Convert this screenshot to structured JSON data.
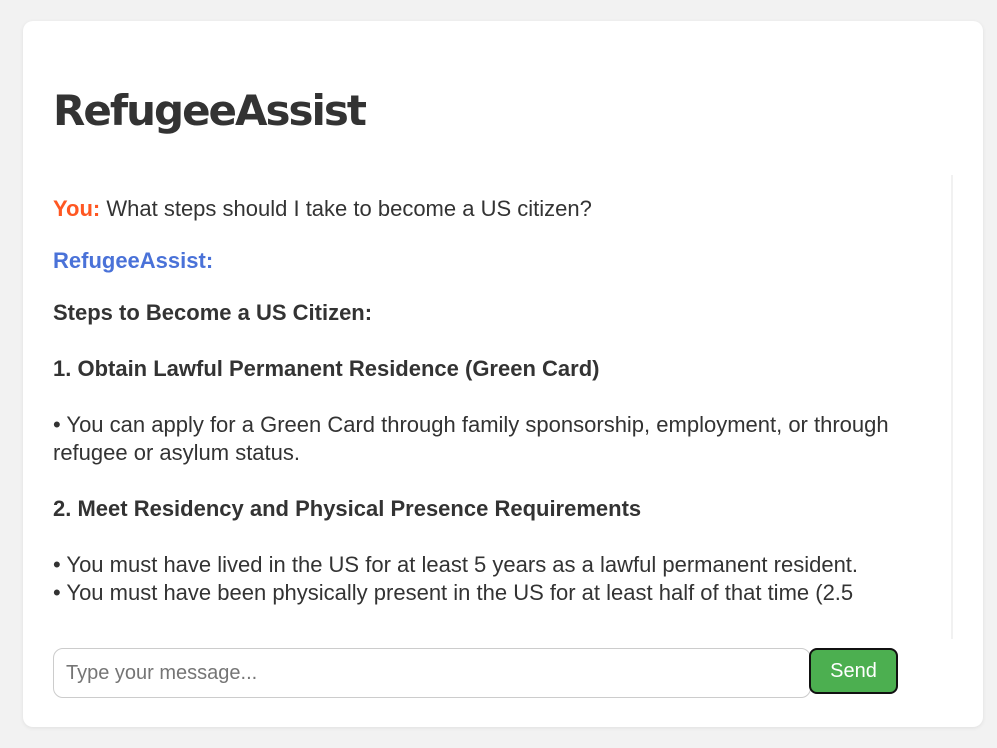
{
  "app": {
    "title": "RefugeeAssist"
  },
  "conversation": {
    "user_label": "You:",
    "user_message": "What steps should I take to become a US citizen?",
    "bot_label": "RefugeeAssist:",
    "response": {
      "title": "Steps to Become a US Citizen:",
      "steps": [
        {
          "heading": "1. Obtain Lawful Permanent Residence (Green Card)",
          "bullets": [
            "• You can apply for a Green Card through family sponsorship, employment, or through refugee or asylum status."
          ]
        },
        {
          "heading": "2. Meet Residency and Physical Presence Requirements",
          "bullets": [
            "• You must have lived in the US for at least 5 years as a lawful permanent resident.",
            "• You must have been physically present in the US for at least half of that time (2.5"
          ]
        }
      ]
    }
  },
  "composer": {
    "placeholder": "Type your message...",
    "send_label": "Send"
  },
  "colors": {
    "user_label": "#ff5722",
    "bot_label": "#4a72d8",
    "send_button": "#4caf50"
  },
  "icons": {
    "scroll_up": "scroll-up-arrow-icon",
    "scroll_down": "scroll-down-arrow-icon"
  }
}
